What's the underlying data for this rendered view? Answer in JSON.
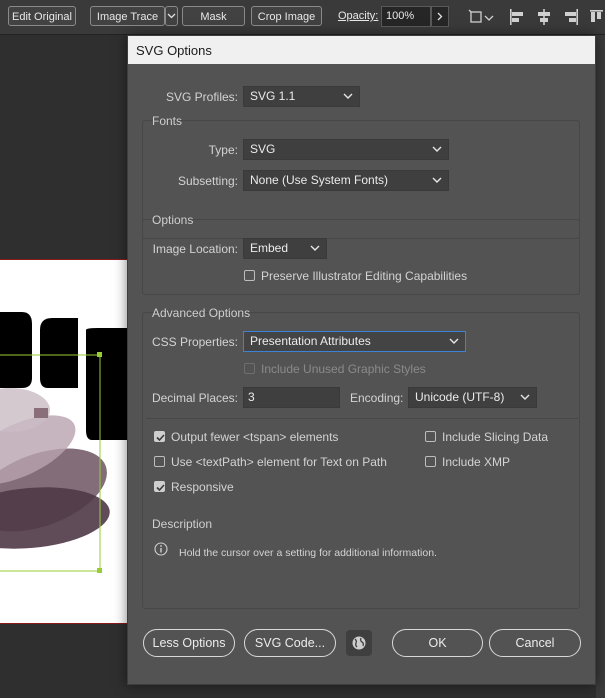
{
  "toolbar": {
    "edit_original": "Edit Original",
    "image_trace": "Image Trace",
    "mask": "Mask",
    "crop_image": "Crop Image",
    "opacity_label": "Opacity:",
    "opacity_value": "100%"
  },
  "dialog": {
    "title": "SVG Options",
    "svg_profiles": {
      "label": "SVG Profiles:",
      "value": "SVG 1.1"
    },
    "fonts": {
      "title": "Fonts",
      "type": {
        "label": "Type:",
        "value": "SVG"
      },
      "subsetting": {
        "label": "Subsetting:",
        "value": "None (Use System Fonts)"
      }
    },
    "options": {
      "title": "Options",
      "image_location": {
        "label": "Image Location:",
        "value": "Embed"
      },
      "preserve_label": "Preserve Illustrator Editing Capabilities",
      "preserve_checked": false
    },
    "advanced": {
      "title": "Advanced Options",
      "css_properties": {
        "label": "CSS Properties:",
        "value": "Presentation Attributes"
      },
      "include_unused_label": "Include Unused Graphic Styles",
      "decimal_places": {
        "label": "Decimal Places:",
        "value": "3"
      },
      "encoding": {
        "label": "Encoding:",
        "value": "Unicode (UTF-8)"
      },
      "output_fewer_label": "Output fewer <tspan> elements",
      "output_fewer_checked": true,
      "use_textpath_label": "Use <textPath> element for Text on Path",
      "use_textpath_checked": false,
      "responsive_label": "Responsive",
      "responsive_checked": true,
      "include_slicing_label": "Include Slicing Data",
      "include_slicing_checked": false,
      "include_xmp_label": "Include XMP",
      "include_xmp_checked": false
    },
    "description": {
      "title": "Description",
      "text": "Hold the cursor over a setting for additional information."
    },
    "buttons": {
      "less_options": "Less Options",
      "svg_code": "SVG Code...",
      "ok": "OK",
      "cancel": "Cancel"
    }
  }
}
